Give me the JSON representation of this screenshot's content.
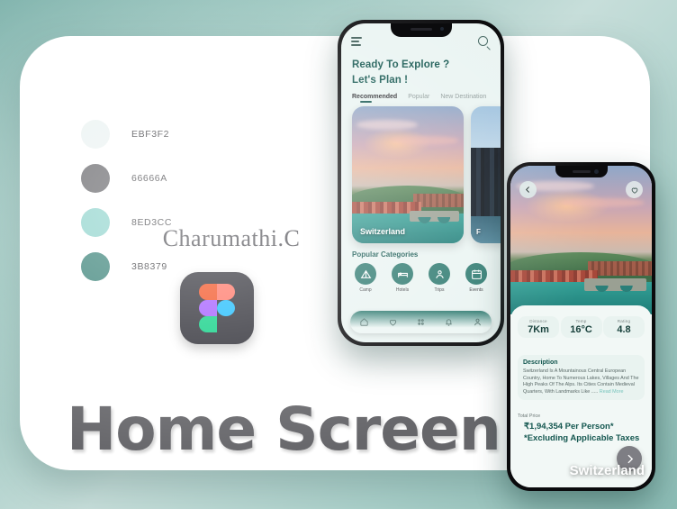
{
  "board": {
    "title": "Home Screen",
    "signature": "Charumathi.C",
    "tool_icon": "figma-logo"
  },
  "palette": [
    {
      "hex": "#EBF3F2",
      "label": "EBF3F2"
    },
    {
      "hex": "#66666A",
      "label": "66666A"
    },
    {
      "hex": "#8ED3CC",
      "label": "8ED3CC"
    },
    {
      "hex": "#3B8379",
      "label": "3B8379"
    }
  ],
  "phone_home": {
    "menu_icon": "hamburger-icon",
    "search_icon": "search-icon",
    "heading_line1": "Ready To Explore ?",
    "heading_line2": "Let's Plan !",
    "tabs": [
      {
        "label": "Recommended",
        "active": true
      },
      {
        "label": "Popular",
        "active": false
      },
      {
        "label": "New Destination",
        "active": false
      }
    ],
    "cards": [
      {
        "name": "Switzerland"
      },
      {
        "name": "F"
      }
    ],
    "categories_title": "Popular Categories",
    "categories": [
      {
        "label": "Camp",
        "icon": "tent-icon"
      },
      {
        "label": "Hotels",
        "icon": "bed-icon"
      },
      {
        "label": "Trips",
        "icon": "trip-pin-icon"
      },
      {
        "label": "Events",
        "icon": "calendar-icon"
      }
    ],
    "nav": [
      {
        "icon": "home-icon"
      },
      {
        "icon": "heart-icon"
      },
      {
        "icon": "grid-icon"
      },
      {
        "icon": "bell-icon"
      },
      {
        "icon": "person-icon"
      }
    ]
  },
  "phone_detail": {
    "back_icon": "chevron-left-icon",
    "favorite_icon": "heart-icon",
    "destination": "Switzerland",
    "stats": [
      {
        "key": "Distance",
        "value": "7Km"
      },
      {
        "key": "Temp",
        "value": "16°C"
      },
      {
        "key": "Rating",
        "value": "4.8"
      }
    ],
    "description_title": "Description",
    "description_text": "Switzerland Is A Mountainous Central European Country, Home To Numerous Lakes, Villages And The High Peaks Of The Alps. Its Cities Contain Medieval Quarters, With Landmarks Like .....",
    "read_more": "Read More",
    "price_label": "Total Price",
    "price_value": "₹1,94,354 Per Person* *Excluding Applicable Taxes",
    "next_icon": "chevron-right-icon"
  }
}
